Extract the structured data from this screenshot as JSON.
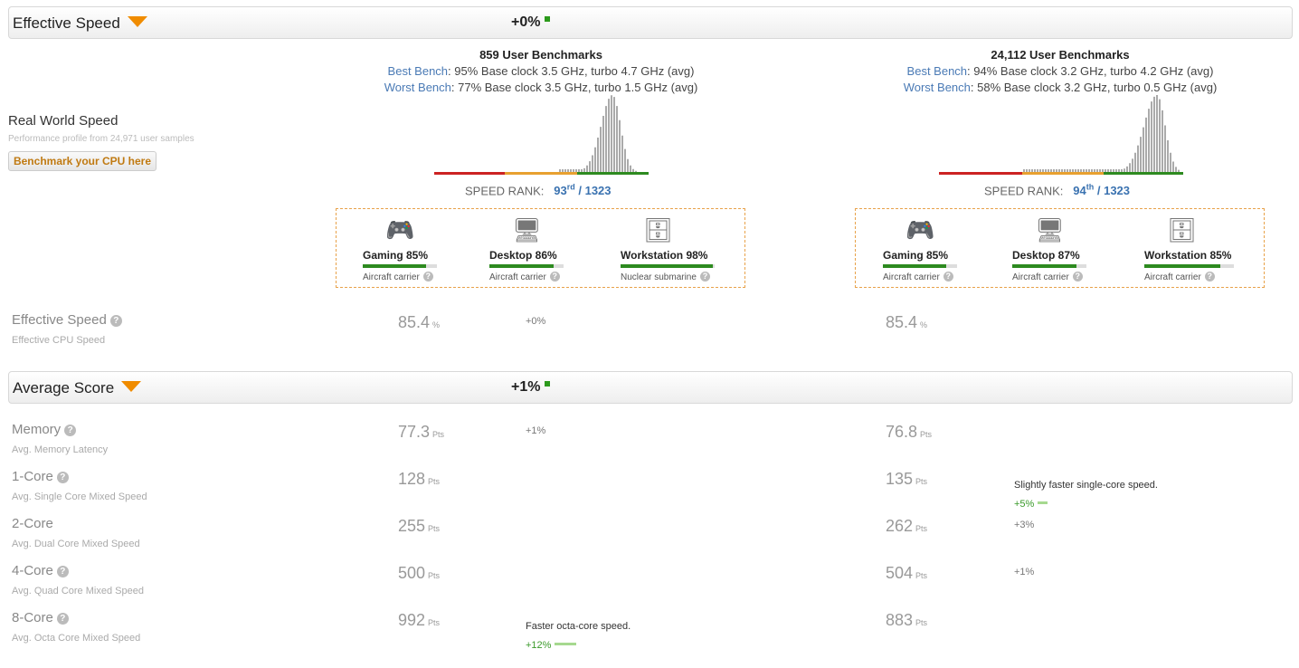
{
  "effective_speed_header": {
    "title": "Effective Speed",
    "delta": "+0%"
  },
  "average_score_header": {
    "title": "Average Score",
    "delta": "+1%"
  },
  "real_world": {
    "title": "Real World Speed",
    "subtitle": "Performance profile from 24,971 user samples",
    "button": "Benchmark your CPU here"
  },
  "cpu_left": {
    "bench_count": "859 User Benchmarks",
    "best_label": "Best Bench",
    "best_text": ": 95% Base clock 3.5 GHz, turbo 4.7 GHz (avg)",
    "worst_label": "Worst Bench",
    "worst_text": ": 77% Base clock 3.5 GHz, turbo 1.5 GHz (avg)",
    "rank_label": "SPEED RANK:",
    "rank_num": "93",
    "rank_sup": "rd",
    "rank_total": "/ 1323",
    "uses": [
      {
        "name": "Gaming 85%",
        "pct": 85,
        "sub": "Aircraft carrier",
        "icon": "gamepad-icon"
      },
      {
        "name": "Desktop 86%",
        "pct": 86,
        "sub": "Aircraft carrier",
        "icon": "monitor-icon"
      },
      {
        "name": "Workstation 98%",
        "pct": 98,
        "sub": "Nuclear submarine",
        "icon": "tower-pc-icon"
      }
    ],
    "effective_speed": "85.4",
    "effective_unit": "%"
  },
  "cpu_right": {
    "bench_count": "24,112 User Benchmarks",
    "best_label": "Best Bench",
    "best_text": ": 94% Base clock 3.2 GHz, turbo 4.2 GHz (avg)",
    "worst_label": "Worst Bench",
    "worst_text": ": 58% Base clock 3.2 GHz, turbo 0.5 GHz (avg)",
    "rank_label": "SPEED RANK:",
    "rank_num": "94",
    "rank_sup": "th",
    "rank_total": "/ 1323",
    "uses": [
      {
        "name": "Gaming 85%",
        "pct": 85,
        "sub": "Aircraft carrier",
        "icon": "gamepad-icon"
      },
      {
        "name": "Desktop 87%",
        "pct": 87,
        "sub": "Aircraft carrier",
        "icon": "monitor-icon"
      },
      {
        "name": "Workstation 85%",
        "pct": 85,
        "sub": "Aircraft carrier",
        "icon": "tower-pc-icon"
      }
    ],
    "effective_speed": "85.4",
    "effective_unit": "%"
  },
  "effective_row": {
    "name": "Effective Speed",
    "sub": "Effective CPU Speed",
    "delta": "+0%"
  },
  "score_rows": [
    {
      "name": "Memory",
      "sub": "Avg. Memory Latency",
      "left": "77.3",
      "right": "76.8",
      "unit": "Pts",
      "note": "",
      "delta": "+1%",
      "delta_side": "left",
      "highlight": false
    },
    {
      "name": "1-Core",
      "sub": "Avg. Single Core Mixed Speed",
      "left": "128",
      "right": "135",
      "unit": "Pts",
      "note": "Slightly faster single-core speed.",
      "delta": "+5%",
      "delta_side": "right",
      "highlight": true
    },
    {
      "name": "2-Core",
      "sub": "Avg. Dual Core Mixed Speed",
      "left": "255",
      "right": "262",
      "unit": "Pts",
      "note": "",
      "delta": "+3%",
      "delta_side": "right",
      "highlight": false
    },
    {
      "name": "4-Core",
      "sub": "Avg. Quad Core Mixed Speed",
      "left": "500",
      "right": "504",
      "unit": "Pts",
      "note": "",
      "delta": "+1%",
      "delta_side": "right",
      "highlight": false
    },
    {
      "name": "8-Core",
      "sub": "Avg. Octa Core Mixed Speed",
      "left": "992",
      "right": "883",
      "unit": "Pts",
      "note": "Faster octa-core speed.",
      "delta": "+12%",
      "delta_side": "left",
      "highlight": true
    }
  ],
  "colors": {
    "accent": "#f08c00",
    "link": "#4a7ab5",
    "good": "#2d8a1f",
    "bad": "#cc2222",
    "mid": "#e8a030"
  }
}
